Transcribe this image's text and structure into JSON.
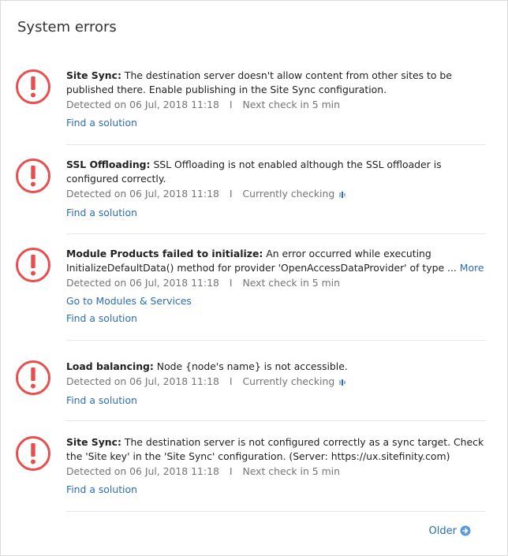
{
  "panel": {
    "title": "System errors"
  },
  "detected_prefix": "Detected on ",
  "errors": [
    {
      "title": "Site Sync:",
      "message": " The destination server doesn't allow content from other sites to be published there. Enable publishing in the Site Sync configuration.",
      "detected": "06 Jul, 2018 11:18",
      "separator": "I",
      "status": "Next check in 5 min",
      "links": [
        "Find a solution"
      ]
    },
    {
      "title": "SSL Offloading:",
      "message": " SSL Offloading is not enabled although the SSL offloader is configured correctly.",
      "detected": "06 Jul, 2018 11:18",
      "separator": "I",
      "status": "Currently checking",
      "links": [
        "Find a solution"
      ]
    },
    {
      "title": "Module Products failed to initialize:",
      "message": " An error occurred while executing InitializeDefaultData() method for provider 'OpenAccessDataProvider' of type ...",
      "more": "More",
      "detected": "06 Jul, 2018 11:18",
      "separator": "I",
      "status": "Next check in 5 min",
      "links": [
        "Go to Modules & Services",
        "Find a solution"
      ]
    },
    {
      "title": "Load balancing:",
      "message": " Node {node's name} is not accessible.",
      "detected": "06 Jul, 2018 11:18",
      "separator": "I",
      "status": "Currently checking",
      "links": [
        "Find a solution"
      ]
    },
    {
      "title": "Site Sync:",
      "message": " The destination server is not configured correctly as a sync target. Check the 'Site key' in the 'Site Sync' configuration. (Server: https://ux.sitefinity.com)",
      "detected": "06 Jul, 2018 11:18",
      "separator": "I",
      "status": "Next check in 5 min",
      "links": [
        "Find a solution"
      ]
    }
  ],
  "footer": {
    "older_label": "Older"
  },
  "colors": {
    "error_red": "#e84e4e",
    "link_blue": "#2a6cb7",
    "meta_gray": "#757575"
  },
  "icons": {
    "error": "exclamation-circle-icon",
    "checking": "checking-indicator-icon",
    "older": "arrow-right-circle-icon"
  }
}
